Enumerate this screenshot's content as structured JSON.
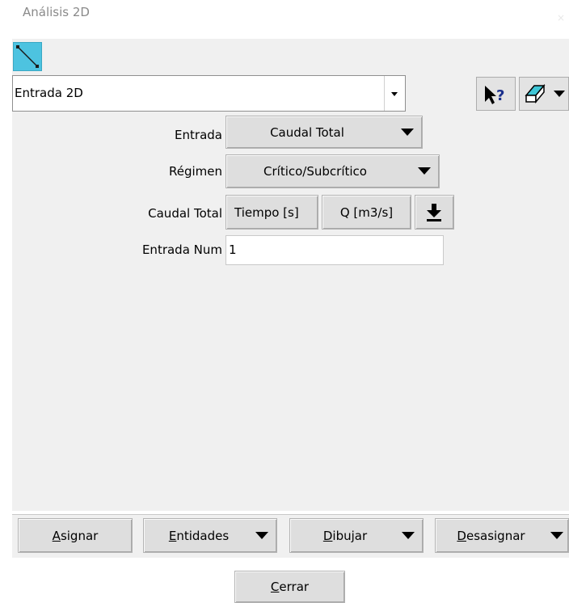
{
  "window": {
    "title": "Análisis 2D",
    "close_label": "×"
  },
  "toolbar": {
    "line_tool_icon": "line-draw-icon",
    "entry_combo_value": "Entrada 2D",
    "help_icon": "whats-this-help-icon",
    "tree_icon": "tree-view-icon"
  },
  "form": {
    "entrada": {
      "label": "Entrada",
      "value": "Caudal Total"
    },
    "regimen": {
      "label": "Régimen",
      "value": "Crítico/Subcrítico"
    },
    "caudal": {
      "label": "Caudal Total",
      "tiempo_button": "Tiempo [s]",
      "q_button": "Q [m3/s]"
    },
    "entrada_num": {
      "label": "Entrada Num",
      "value": "1"
    }
  },
  "actions": {
    "asignar": {
      "first": "A",
      "rest": "signar"
    },
    "entidades": {
      "first": "E",
      "rest": "ntidades"
    },
    "dibujar": {
      "first": "D",
      "rest": "ibujar"
    },
    "desasignar": {
      "first": "D",
      "rest": "esasignar"
    },
    "cerrar": {
      "first": "C",
      "rest": "errar"
    }
  },
  "colors": {
    "line_tool_bg": "#4dc3e0",
    "panel_bg": "#f0f0f0",
    "button_bg": "#dedede"
  }
}
